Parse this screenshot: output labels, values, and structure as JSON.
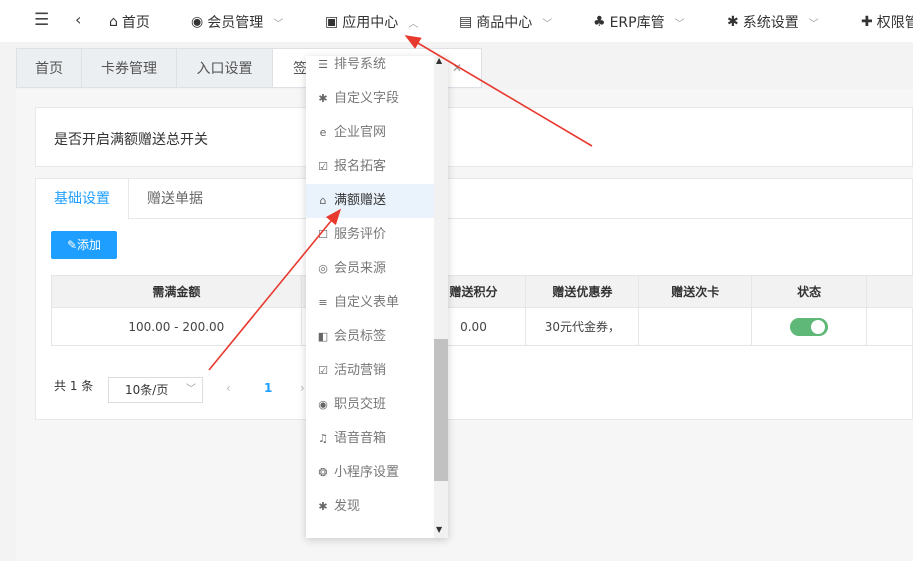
{
  "topbar": {
    "items": [
      {
        "label": "首页",
        "icon": "home-icon"
      },
      {
        "label": "会员管理",
        "icon": "user-circle-icon"
      },
      {
        "label": "应用中心",
        "icon": "rss-icon"
      },
      {
        "label": "商品中心",
        "icon": "briefcase-icon"
      },
      {
        "label": "ERP库管",
        "icon": "sitemap-icon"
      },
      {
        "label": "系统设置",
        "icon": "gear-icon"
      },
      {
        "label": "权限管",
        "icon": "puzzle-icon"
      }
    ]
  },
  "tabs": [
    "首页",
    "卡券管理",
    "入口设置",
    "签"
  ],
  "switch_card": {
    "label": "是否开启满额赠送总开关"
  },
  "inner_tabs": [
    "基础设置",
    "赠送单据"
  ],
  "add_button": "添加",
  "table": {
    "headers": [
      "需满金额",
      "",
      "赠送积分",
      "赠送优惠券",
      "赠送次卡",
      "状态",
      ""
    ],
    "rows": [
      {
        "amount": "100.00 - 200.00",
        "points": "0.00",
        "coupon": "30元代金券，",
        "card": "",
        "status": true
      }
    ]
  },
  "pager": {
    "total": "共 1 条",
    "size": "10条/页",
    "current": "1"
  },
  "dropdown": {
    "items": [
      {
        "label": "排号系统",
        "icon": "list-icon"
      },
      {
        "label": "自定义字段",
        "icon": "asterisk-icon"
      },
      {
        "label": "企业官网",
        "icon": "ie-icon"
      },
      {
        "label": "报名拓客",
        "icon": "calendar-check-icon"
      },
      {
        "label": "满额赠送",
        "icon": "gift-icon"
      },
      {
        "label": "服务评价",
        "icon": "square-icon"
      },
      {
        "label": "会员来源",
        "icon": "podcast-icon"
      },
      {
        "label": "自定义表单",
        "icon": "align-left-icon"
      },
      {
        "label": "会员标签",
        "icon": "tag-icon"
      },
      {
        "label": "活动营销",
        "icon": "calendar-icon"
      },
      {
        "label": "职员交班",
        "icon": "user-circle-icon"
      },
      {
        "label": "语音音箱",
        "icon": "music-icon"
      },
      {
        "label": "小程序设置",
        "icon": "wechat-icon"
      },
      {
        "label": "发现",
        "icon": "asterisk-icon"
      }
    ]
  },
  "colors": {
    "accent": "#1E9FFF",
    "toggle_on": "#5FB878",
    "arrow": "#E8392F"
  }
}
